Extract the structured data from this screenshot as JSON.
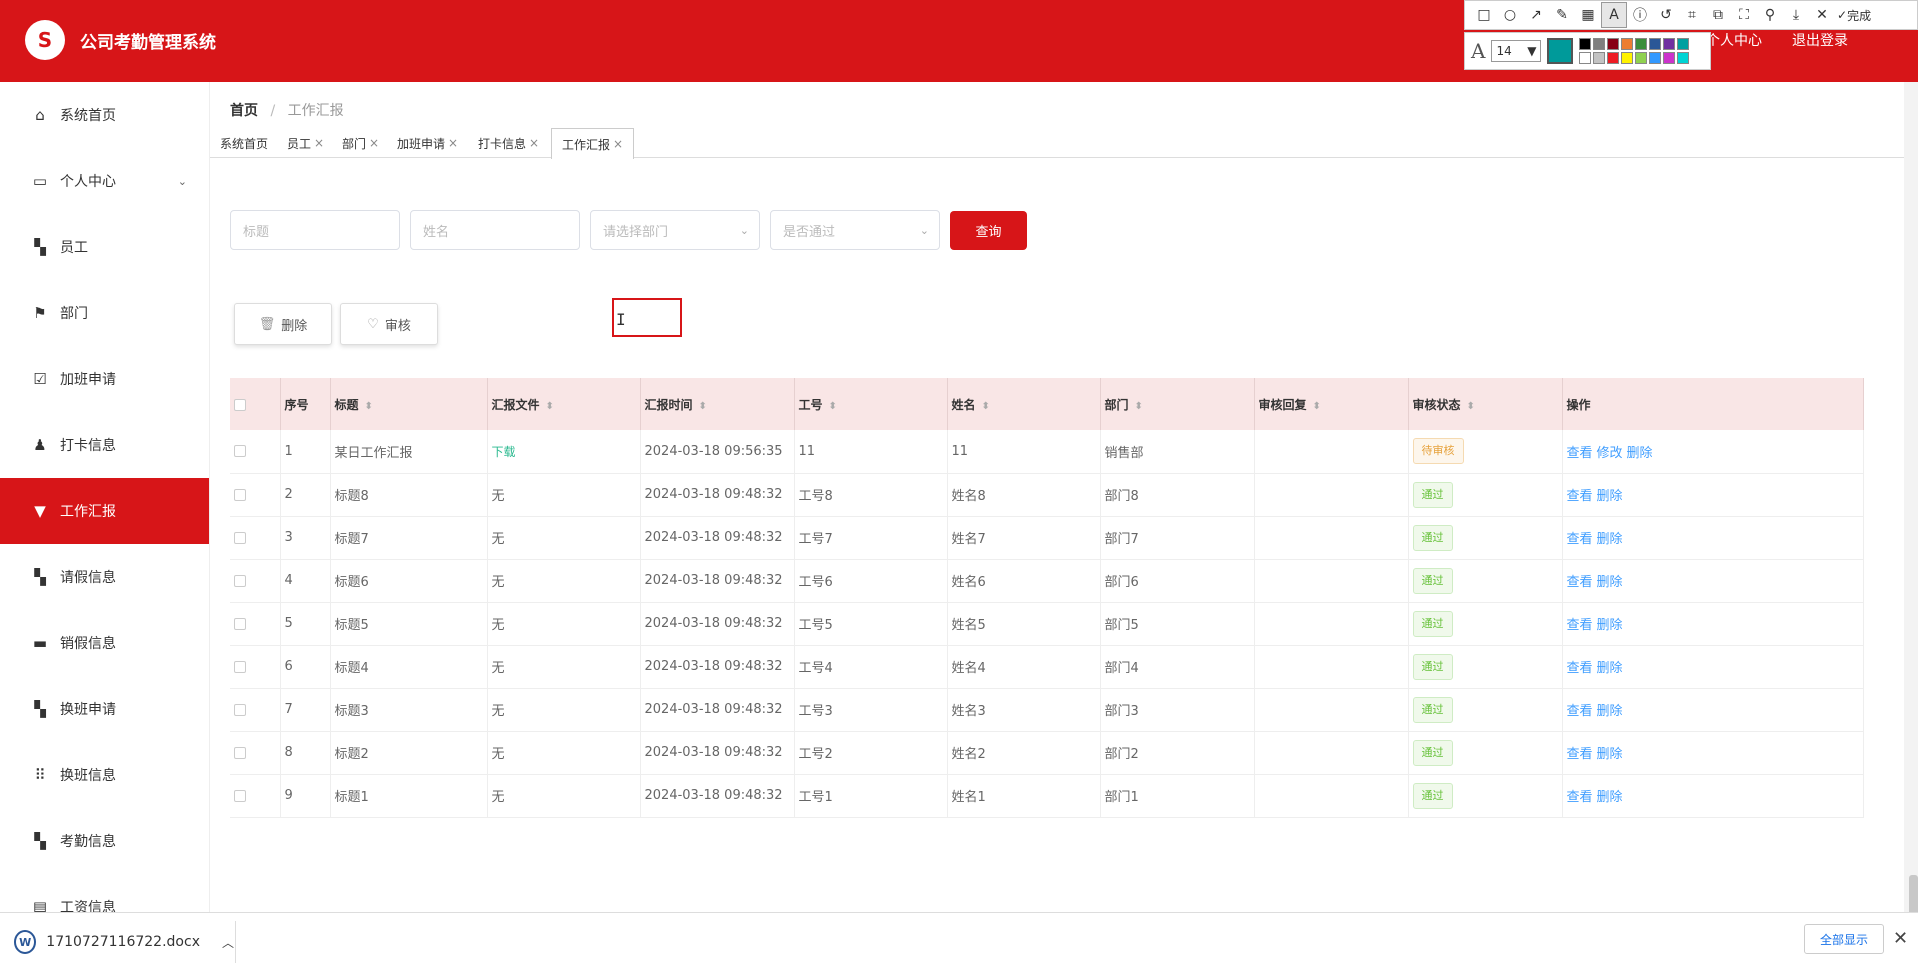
{
  "app": {
    "title": "公司考勤管理系统",
    "logo_glyph": "S"
  },
  "header": {
    "links": [
      "个人中心",
      "退出登录"
    ]
  },
  "annotation_toolbar": {
    "tools": [
      "rect-icon",
      "circle-icon",
      "arrow-icon",
      "pencil-icon",
      "mosaic-icon",
      "text-icon",
      "info-icon",
      "undo-icon",
      "crop-icon",
      "copy-icon",
      "fullscreen-icon",
      "pin-icon",
      "download-icon",
      "close-icon"
    ],
    "done_label": "完成",
    "font_size": "14",
    "current_color": "#009a9a",
    "palette": [
      "#000000",
      "#7f7f7f",
      "#880015",
      "#ed7d31",
      "#3a8e3a",
      "#2b5797",
      "#7030a0",
      "#00a0a0",
      "#ffffff",
      "#c3c3c3",
      "#ed1c24",
      "#fff200",
      "#8fd14f",
      "#3399ff",
      "#cc33cc",
      "#00d4d4"
    ]
  },
  "sidebar": {
    "items": [
      {
        "label": "系统首页",
        "icon": "home-icon"
      },
      {
        "label": "个人中心",
        "icon": "card-icon",
        "has_children": true
      },
      {
        "label": "员工",
        "icon": "grid-icon"
      },
      {
        "label": "部门",
        "icon": "flag-icon"
      },
      {
        "label": "加班申请",
        "icon": "clipboard-check-icon"
      },
      {
        "label": "打卡信息",
        "icon": "user-icon"
      },
      {
        "label": "工作汇报",
        "icon": "stamp-icon",
        "active": true
      },
      {
        "label": "请假信息",
        "icon": "grid-icon"
      },
      {
        "label": "销假信息",
        "icon": "briefcase-icon"
      },
      {
        "label": "换班申请",
        "icon": "grid-icon"
      },
      {
        "label": "换班信息",
        "icon": "apps-icon"
      },
      {
        "label": "考勤信息",
        "icon": "grid-icon"
      },
      {
        "label": "工资信息",
        "icon": "clipboard-icon"
      }
    ]
  },
  "breadcrumb": {
    "home": "首页",
    "current": "工作汇报"
  },
  "tabs": [
    {
      "label": "系统首页",
      "closable": false
    },
    {
      "label": "员工",
      "closable": true
    },
    {
      "label": "部门",
      "closable": true
    },
    {
      "label": "加班申请",
      "closable": true
    },
    {
      "label": "打卡信息",
      "closable": true
    },
    {
      "label": "工作汇报",
      "closable": true,
      "active": true
    }
  ],
  "filters": {
    "title_placeholder": "标题",
    "name_placeholder": "姓名",
    "dept_placeholder": "请选择部门",
    "pass_placeholder": "是否通过",
    "query_label": "查询"
  },
  "actions": {
    "delete_label": "删除",
    "review_label": "审核"
  },
  "table": {
    "columns": [
      "序号",
      "标题",
      "汇报文件",
      "汇报时间",
      "工号",
      "姓名",
      "部门",
      "审核回复",
      "审核状态",
      "操作"
    ],
    "rows": [
      {
        "no": "1",
        "title": "某日工作汇报",
        "file": "下载",
        "time": "2024-03-18 09:56:35",
        "emp_no": "11",
        "name": "11",
        "dept": "销售部",
        "reply": "",
        "status": "待审核",
        "ops": [
          "查看",
          "修改",
          "删除"
        ]
      },
      {
        "no": "2",
        "title": "标题8",
        "file": "无",
        "time": "2024-03-18 09:48:32",
        "emp_no": "工号8",
        "name": "姓名8",
        "dept": "部门8",
        "reply": "",
        "status": "通过",
        "ops": [
          "查看",
          "删除"
        ]
      },
      {
        "no": "3",
        "title": "标题7",
        "file": "无",
        "time": "2024-03-18 09:48:32",
        "emp_no": "工号7",
        "name": "姓名7",
        "dept": "部门7",
        "reply": "",
        "status": "通过",
        "ops": [
          "查看",
          "删除"
        ]
      },
      {
        "no": "4",
        "title": "标题6",
        "file": "无",
        "time": "2024-03-18 09:48:32",
        "emp_no": "工号6",
        "name": "姓名6",
        "dept": "部门6",
        "reply": "",
        "status": "通过",
        "ops": [
          "查看",
          "删除"
        ]
      },
      {
        "no": "5",
        "title": "标题5",
        "file": "无",
        "time": "2024-03-18 09:48:32",
        "emp_no": "工号5",
        "name": "姓名5",
        "dept": "部门5",
        "reply": "",
        "status": "通过",
        "ops": [
          "查看",
          "删除"
        ]
      },
      {
        "no": "6",
        "title": "标题4",
        "file": "无",
        "time": "2024-03-18 09:48:32",
        "emp_no": "工号4",
        "name": "姓名4",
        "dept": "部门4",
        "reply": "",
        "status": "通过",
        "ops": [
          "查看",
          "删除"
        ]
      },
      {
        "no": "7",
        "title": "标题3",
        "file": "无",
        "time": "2024-03-18 09:48:32",
        "emp_no": "工号3",
        "name": "姓名3",
        "dept": "部门3",
        "reply": "",
        "status": "通过",
        "ops": [
          "查看",
          "删除"
        ]
      },
      {
        "no": "8",
        "title": "标题2",
        "file": "无",
        "time": "2024-03-18 09:48:32",
        "emp_no": "工号2",
        "name": "姓名2",
        "dept": "部门2",
        "reply": "",
        "status": "通过",
        "ops": [
          "查看",
          "删除"
        ]
      },
      {
        "no": "9",
        "title": "标题1",
        "file": "无",
        "time": "2024-03-18 09:48:32",
        "emp_no": "工号1",
        "name": "姓名1",
        "dept": "部门1",
        "reply": "",
        "status": "通过",
        "ops": [
          "查看",
          "删除"
        ]
      }
    ]
  },
  "download_bar": {
    "filename": "1710727116722.docx",
    "show_all_label": "全部显示"
  },
  "colors": {
    "brand": "#d71518",
    "header_row": "#f9e6e6",
    "link": "#409eff",
    "pass": "#67c23a",
    "pending": "#e6a23c"
  }
}
